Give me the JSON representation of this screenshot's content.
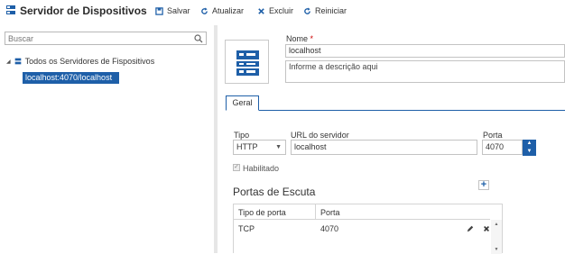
{
  "header": {
    "title": "Servidor de Dispositivos",
    "toolbar": {
      "save": "Salvar",
      "refresh": "Atualizar",
      "delete": "Excluir",
      "restart": "Reiniciar"
    }
  },
  "sidebar": {
    "search_placeholder": "Buscar",
    "tree": {
      "root_label": "Todos os Servidores de Fispositivos",
      "child_label": "localhost:4070/localhost"
    }
  },
  "form": {
    "name_label": "Nome",
    "required_mark": "*",
    "name_value": "localhost",
    "description_placeholder": "Informe a descrição aqui",
    "tabs": [
      "Geral"
    ],
    "type_label": "Tipo",
    "type_value": "HTTP",
    "url_label": "URL do servidor",
    "url_value": "localhost",
    "port_label": "Porta",
    "port_value": "4070",
    "enabled_label": "Habilitado",
    "enabled_checked": true
  },
  "listen_ports": {
    "title": "Portas de Escuta",
    "columns": [
      "Tipo de porta",
      "Porta"
    ],
    "rows": [
      {
        "type": "TCP",
        "port": "4070"
      }
    ]
  },
  "colors": {
    "accent": "#1e5fa8",
    "required": "#cc0000"
  }
}
